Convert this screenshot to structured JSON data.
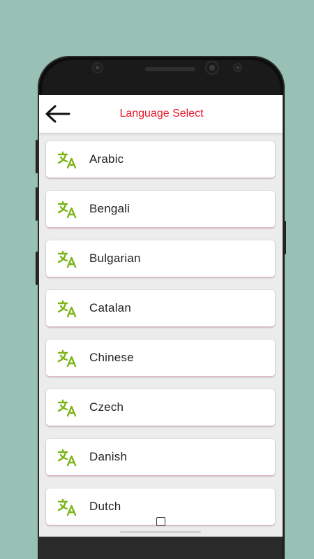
{
  "header": {
    "title": "Language Select",
    "back_icon": "back-arrow-icon"
  },
  "colors": {
    "title": "#e8192c",
    "icon_green": "#7cb518",
    "background": "#98c0b4"
  },
  "languages": [
    {
      "label": "Arabic",
      "icon": "translate-icon"
    },
    {
      "label": "Bengali",
      "icon": "translate-icon"
    },
    {
      "label": "Bulgarian",
      "icon": "translate-icon"
    },
    {
      "label": "Catalan",
      "icon": "translate-icon"
    },
    {
      "label": "Chinese",
      "icon": "translate-icon"
    },
    {
      "label": "Czech",
      "icon": "translate-icon"
    },
    {
      "label": "Danish",
      "icon": "translate-icon"
    },
    {
      "label": "Dutch",
      "icon": "translate-icon"
    }
  ]
}
